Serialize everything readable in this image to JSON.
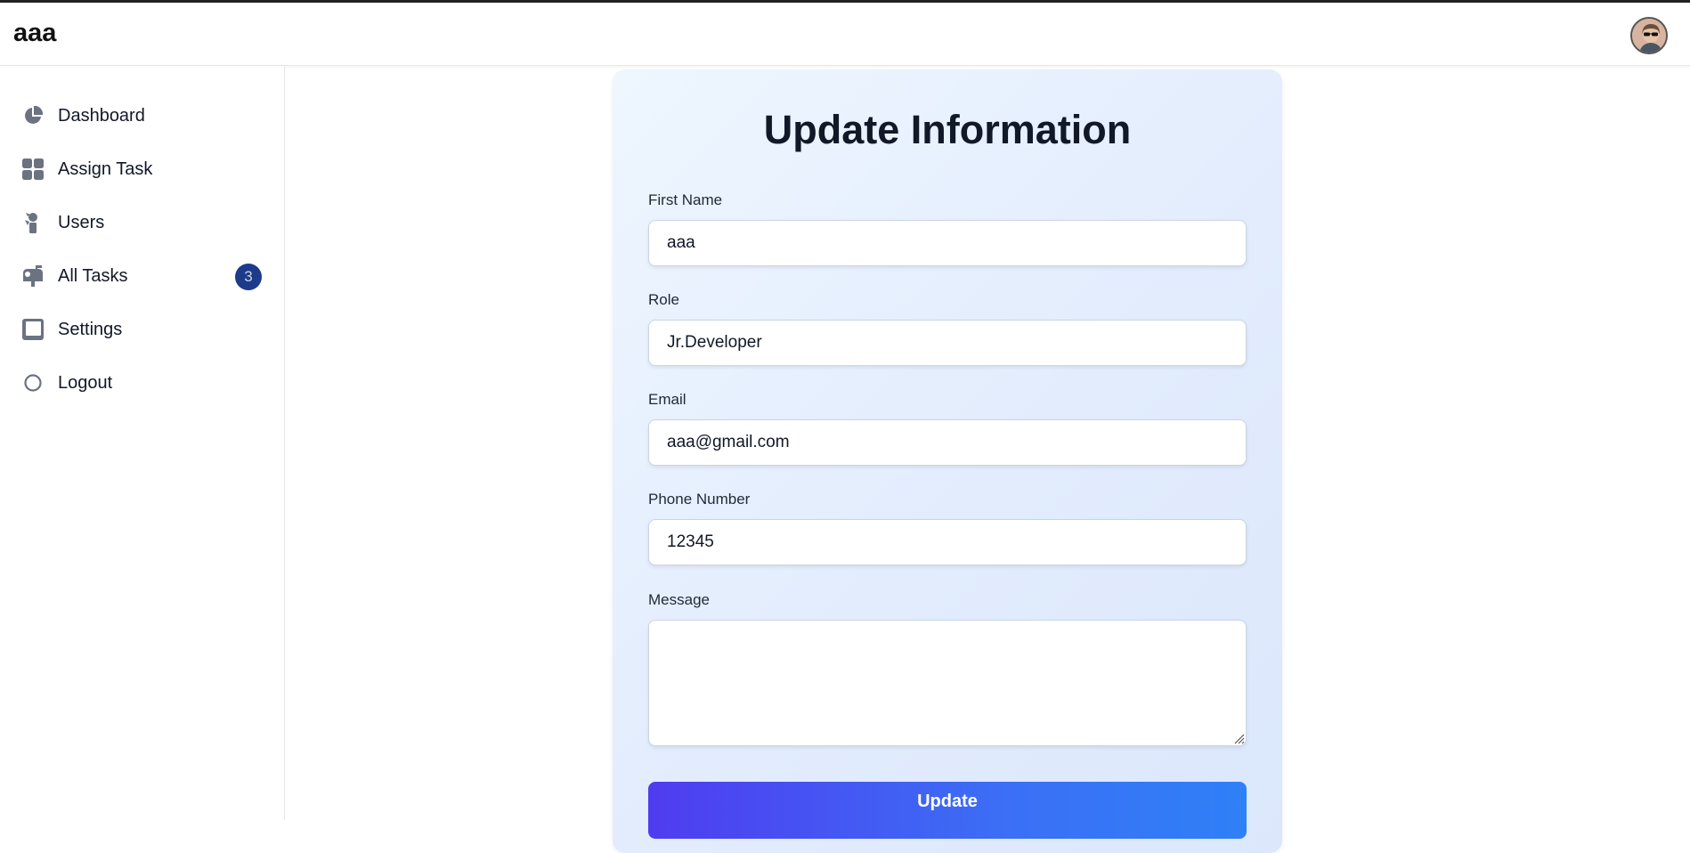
{
  "app": {
    "brand": "aaa"
  },
  "user": {
    "avatar_icon": "user-avatar"
  },
  "sidebar": {
    "items": [
      {
        "label": "Dashboard",
        "icon": "pie-chart-icon"
      },
      {
        "label": "Assign Task",
        "icon": "grid-icon"
      },
      {
        "label": "Users",
        "icon": "users-icon"
      },
      {
        "label": "All Tasks",
        "icon": "mailbox-icon",
        "badge": "3"
      },
      {
        "label": "Settings",
        "icon": "panel-icon"
      },
      {
        "label": "Logout",
        "icon": "circle-icon"
      }
    ],
    "badge_color": "#1e3a8a",
    "icon_color": "#6b7280"
  },
  "form": {
    "title": "Update Information",
    "fields": [
      {
        "label": "First Name",
        "value": "aaa"
      },
      {
        "label": "Role",
        "value": "Jr.Developer"
      },
      {
        "label": "Email",
        "value": "aaa@gmail.com"
      },
      {
        "label": "Phone Number",
        "value": "12345"
      }
    ],
    "message": {
      "label": "Message",
      "value": ""
    },
    "submit_label": "Update",
    "button_gradient": [
      "#4f3cf0",
      "#2f80f7"
    ]
  }
}
